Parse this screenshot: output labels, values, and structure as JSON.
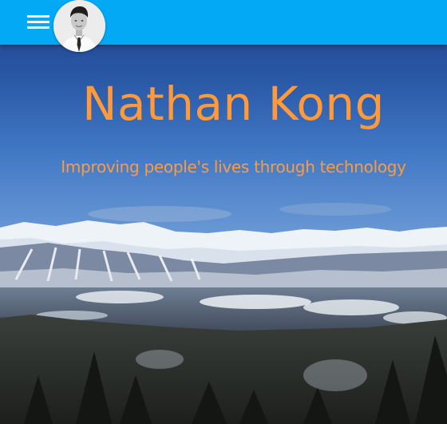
{
  "header": {
    "menu_icon": "hamburger-menu-icon",
    "avatar_alt": "Nathan Kong profile photo",
    "bar_color": "#03a9f4"
  },
  "hero": {
    "title": "Nathan Kong",
    "subtitle": "Improving people's lives through technology",
    "text_color": "#ff9a3c",
    "background": "mountain-landscape-image"
  }
}
